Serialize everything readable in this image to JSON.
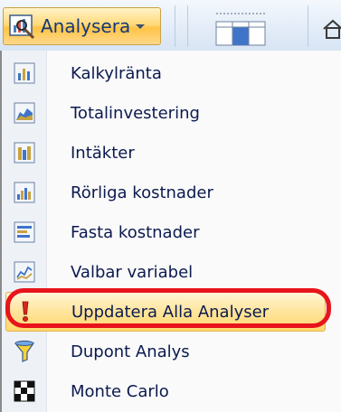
{
  "ribbon": {
    "analyse_button_label": "Analysera",
    "analyse_icon": "chart-analysis-icon",
    "gallery_icon": "table-layout-icon",
    "home_icon": "home-icon"
  },
  "menu": {
    "items": [
      {
        "label": "Kalkylränta",
        "icon": "bar-chart-icon"
      },
      {
        "label": "Totalinvestering",
        "icon": "area-chart-icon"
      },
      {
        "label": "Intäkter",
        "icon": "column-chart-icon"
      },
      {
        "label": "Rörliga kostnader",
        "icon": "histogram-icon"
      },
      {
        "label": "Fasta kostnader",
        "icon": "grouped-bar-icon"
      },
      {
        "label": "Valbar variabel",
        "icon": "line-chart-icon"
      },
      {
        "label": "Uppdatera Alla Analyser",
        "icon": "exclamation-icon",
        "highlighted": true
      },
      {
        "label": "Dupont Analys",
        "icon": "funnel-icon"
      },
      {
        "label": "Monte Carlo",
        "icon": "checkerboard-icon"
      }
    ]
  },
  "colors": {
    "menu_text": "#0b1a4f",
    "highlight_ring": "#e8141c",
    "hover_fill": "#ffe49b"
  }
}
